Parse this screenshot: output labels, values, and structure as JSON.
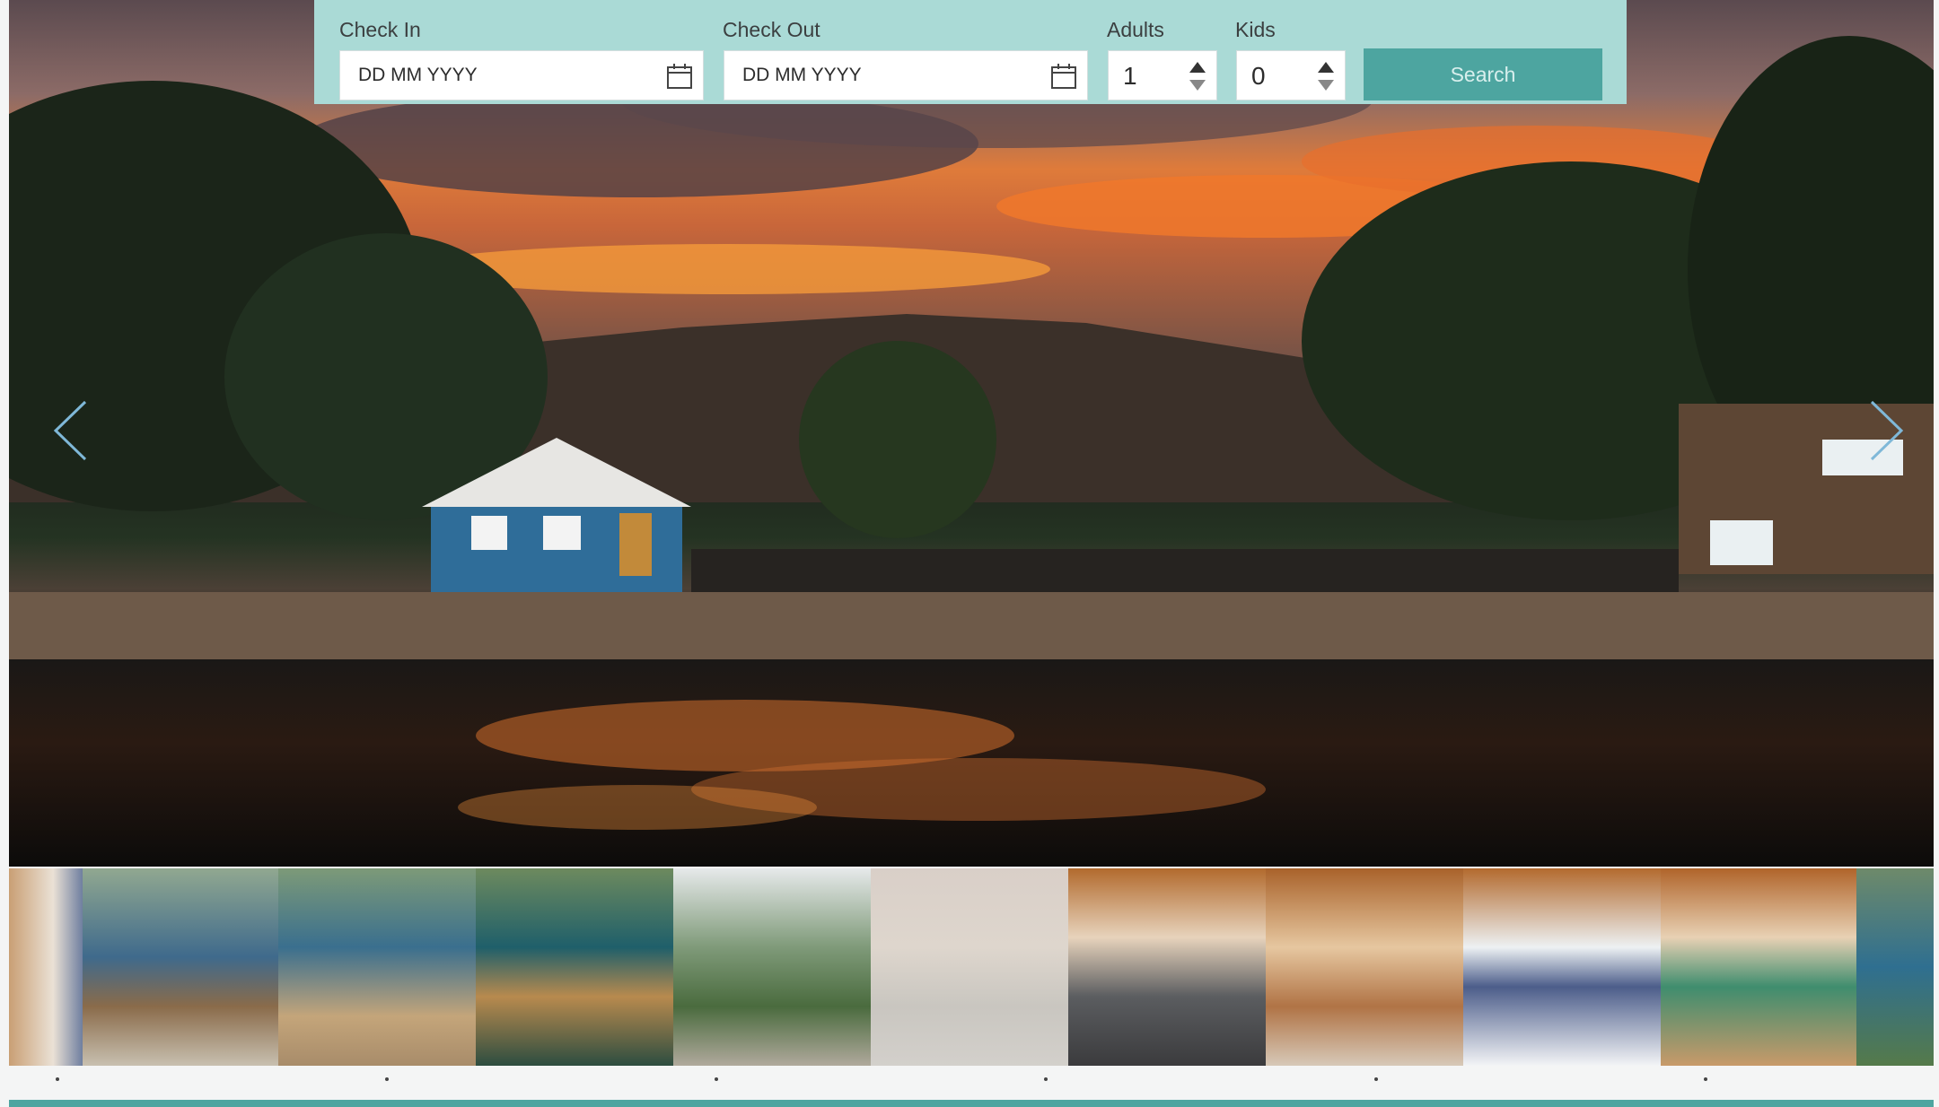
{
  "booking": {
    "check_in_label": "Check In",
    "check_in_placeholder": "DD MM YYYY",
    "check_out_label": "Check Out",
    "check_out_placeholder": "DD MM YYYY",
    "adults_label": "Adults",
    "adults_value": "1",
    "kids_label": "Kids",
    "kids_value": "0",
    "search_label": "Search"
  },
  "hero": {
    "description_icon_left": "chevron-left-icon",
    "description_icon_right": "chevron-right-icon"
  },
  "gallery": {
    "thumbnail_count": 11,
    "dot_count": 6
  },
  "colors": {
    "accent": "#4da5a0",
    "booking_bar": "#aadad6"
  }
}
